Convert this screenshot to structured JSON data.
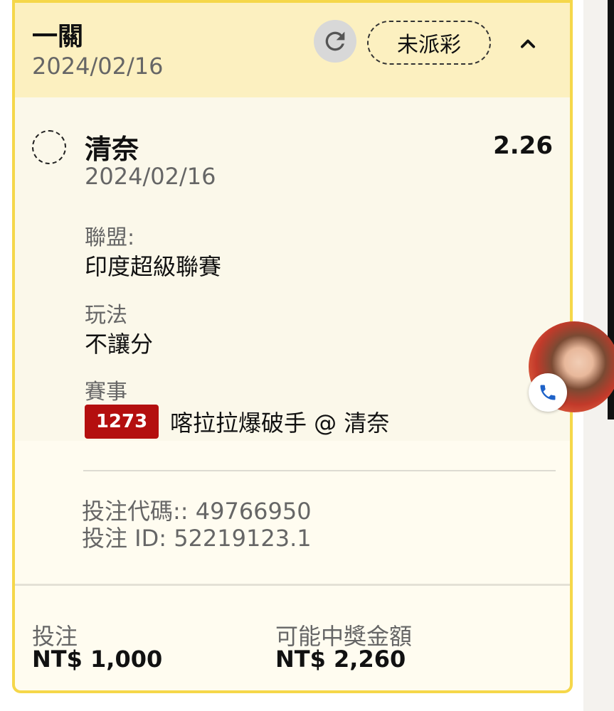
{
  "card": {
    "title": "一關",
    "date": "2024/02/16",
    "status": "未派彩"
  },
  "selection": {
    "name": "清奈",
    "odds": "2.26",
    "date": "2024/02/16",
    "league_label": "聯盟:",
    "league_value": "印度超級聯賽",
    "market_label": "玩法",
    "market_value": "不讓分",
    "event_label": "賽事",
    "event_id": "1273",
    "event_name": "喀拉拉爆破手 @ 清奈"
  },
  "bet_info": {
    "code_line": "投注代碼:: 49766950",
    "id_line": "投注 ID: 52219123.1"
  },
  "footer": {
    "stake_label": "投注",
    "stake_value": "NT$ 1,000",
    "payout_label": "可能中獎金額",
    "payout_value": "NT$ 2,260"
  },
  "colors": {
    "header_bg": "#fcf0c0",
    "border": "#f5d74a",
    "badge": "#b40f0f",
    "phone": "#1e62c8"
  },
  "icons": {
    "refresh": "refresh-icon",
    "collapse": "chevron-up-icon",
    "phone": "phone-icon"
  }
}
